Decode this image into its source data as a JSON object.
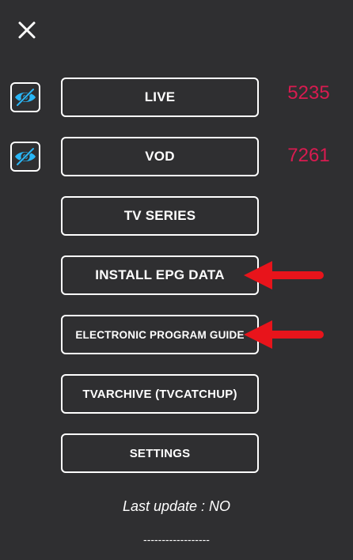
{
  "header": {
    "close_icon": "close-icon"
  },
  "menu": {
    "live_label": "LIVE",
    "vod_label": "VOD",
    "tv_series_label": "TV SERIES",
    "install_epg_label": "INSTALL EPG DATA",
    "epg_guide_label": "ELECTRONIC PROGRAM GUIDE",
    "tvarchive_label": "TVARCHIVE (TVCATCHUP)",
    "settings_label": "SETTINGS"
  },
  "counts": {
    "live": "5235",
    "vod": "7261"
  },
  "visibility_icons": {
    "live": "eye-slash-icon",
    "vod": "eye-slash-icon"
  },
  "footer": {
    "last_update": "Last update : NO",
    "divider": "------------------"
  },
  "colors": {
    "background": "#2f2f31",
    "count": "#d81b50",
    "eye_icon": "#29b6f6",
    "arrow": "#e8141b"
  }
}
